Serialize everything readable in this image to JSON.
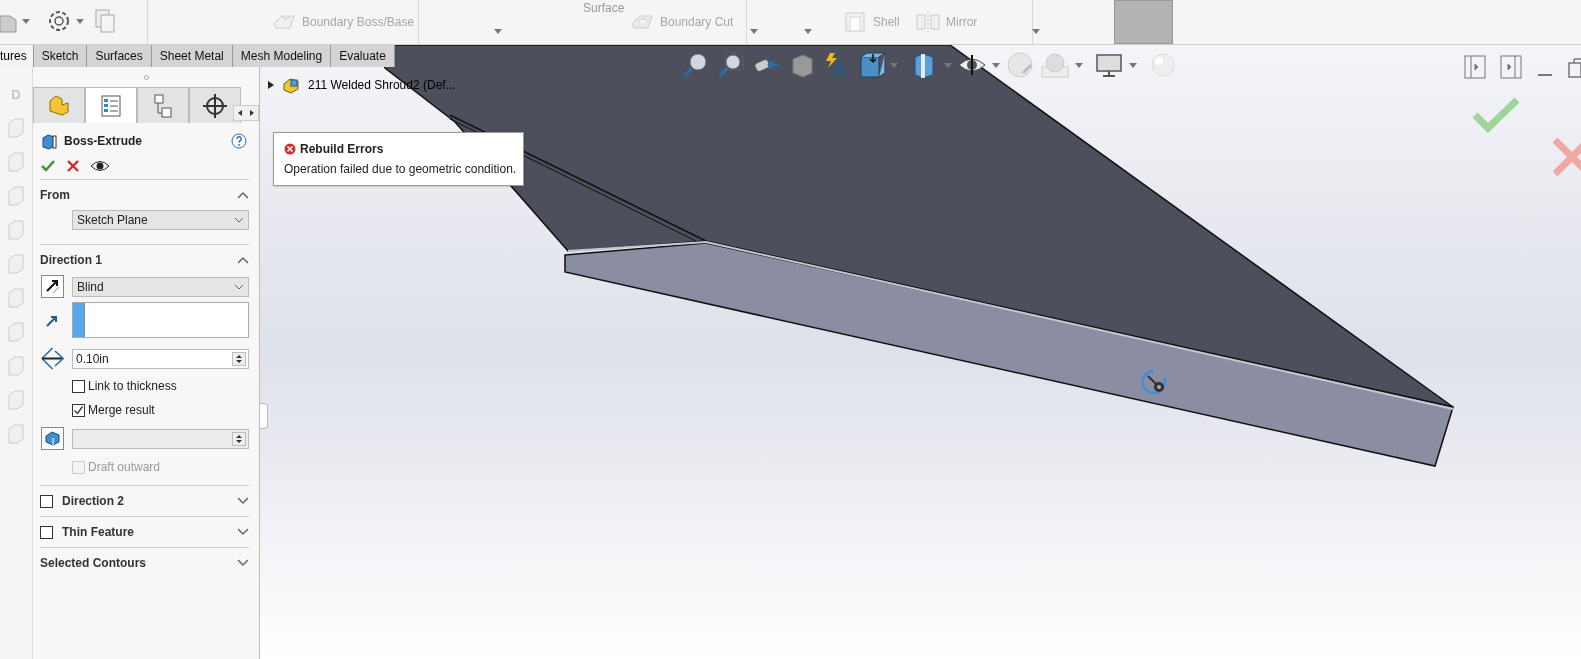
{
  "ribbon": {
    "group_label": "Surface",
    "commands": [
      {
        "label": "Boundary Boss/Base",
        "kind": "boundary_boss",
        "disabled": true
      },
      {
        "label": "Boundary Cut",
        "kind": "boundary_cut",
        "disabled": true
      },
      {
        "label": "Shell",
        "kind": "shell",
        "disabled": true
      },
      {
        "label": "Mirror",
        "kind": "mirror",
        "disabled": true
      }
    ]
  },
  "command_tabs": [
    {
      "label": "tures",
      "selected": true
    },
    {
      "label": "Sketch",
      "selected": false
    },
    {
      "label": "Surfaces",
      "selected": false
    },
    {
      "label": "Sheet Metal",
      "selected": false
    },
    {
      "label": "Mesh Modeling",
      "selected": false
    },
    {
      "label": "Evaluate",
      "selected": false
    }
  ],
  "command_strip": {
    "label": "D"
  },
  "feature_tree": {
    "label": "211 Welded Shroud2  (Def...",
    "expanded": false
  },
  "tooltip": {
    "title": "Rebuild Errors",
    "message": "Operation failed due to geometric condition."
  },
  "property_manager": {
    "title": "Boss-Extrude",
    "panel_tabs": [
      {
        "kind": "feature",
        "selected": false
      },
      {
        "kind": "property",
        "selected": true
      },
      {
        "kind": "config",
        "selected": false
      },
      {
        "kind": "dimxpert",
        "selected": false
      }
    ],
    "sections": [
      {
        "kind": "plain",
        "title": "From",
        "expanded": true,
        "rows": [
          {
            "kind": "dropdown",
            "value": "Sketch Plane"
          }
        ]
      },
      {
        "kind": "plain",
        "title": "Direction 1",
        "expanded": true,
        "rows": [
          {
            "kind": "end_condition",
            "value": "Blind"
          },
          {
            "kind": "selection"
          },
          {
            "kind": "depth",
            "value": "0.10in"
          },
          {
            "kind": "checkbox",
            "label": "Link to thickness",
            "checked": false,
            "disabled": false
          },
          {
            "kind": "checkbox",
            "label": "Merge result",
            "checked": true,
            "disabled": false
          },
          {
            "kind": "draft",
            "disabled": true
          },
          {
            "kind": "checkbox",
            "label": "Draft outward",
            "checked": false,
            "disabled": true
          }
        ]
      },
      {
        "kind": "checkable",
        "title": "Direction 2",
        "checked": false,
        "expanded": false
      },
      {
        "kind": "checkable",
        "title": "Thin Feature",
        "checked": false,
        "expanded": false
      },
      {
        "kind": "plain",
        "title": "Selected Contours",
        "expanded": false
      }
    ]
  }
}
